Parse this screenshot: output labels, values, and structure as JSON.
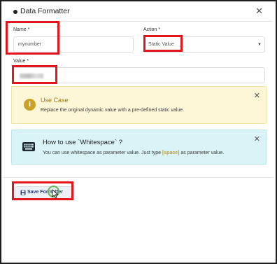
{
  "modal": {
    "title": "Data Formatter"
  },
  "form": {
    "name_label": "Name *",
    "name_value": "mynumber",
    "action_label": "Action *",
    "action_value": "Static Value",
    "value_label": "Value *"
  },
  "use_case": {
    "title": "Use Case",
    "text": "Replace the original dynamic value with a pre-defined static value."
  },
  "how_to": {
    "title": "How to use `Whitespace` ?",
    "text_before": "You can use whitespace as parameter value. Just type ",
    "code": "[space]",
    "text_after": " as parameter value."
  },
  "footer": {
    "save_label": "Save Formatter"
  },
  "colors": {
    "highlight_red": "#e3151d",
    "use_case_bg": "#fdf6d7",
    "how_to_bg": "#d9f3f7",
    "accent_gold": "#c9a227"
  },
  "icons": {
    "header_bullet": "dot-icon",
    "close": "close-icon",
    "use_case": "info-icon",
    "how_to": "keyboard-icon",
    "save": "save-icon",
    "dropdown": "chevron-down-icon"
  }
}
